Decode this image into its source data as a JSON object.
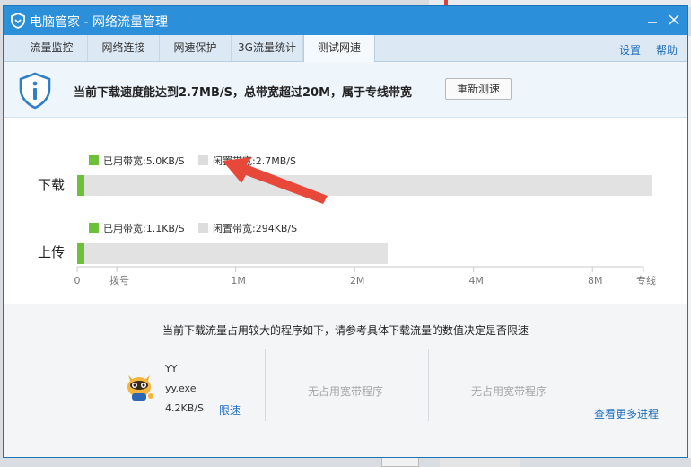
{
  "window": {
    "title": "电脑管家 - 网络流量管理"
  },
  "tabs": [
    {
      "label": "流量监控"
    },
    {
      "label": "网络连接"
    },
    {
      "label": "网速保护"
    },
    {
      "label": "3G流量统计"
    },
    {
      "label": "测试网速",
      "active": true
    }
  ],
  "toplinks": {
    "settings": "设置",
    "help": "帮助"
  },
  "banner": {
    "headline": "当前下载速度能达到2.7MB/S，总带宽超过20M，属于专线带宽",
    "retest_label": "重新测速"
  },
  "speed_chart": {
    "download": {
      "label": "下载",
      "used_legend": "已用带宽:5.0KB/S",
      "idle_legend": "闲置带宽:2.7MB/S",
      "used_fraction": 0.012,
      "total_fraction": 1.0
    },
    "upload": {
      "label": "上传",
      "used_legend": "已用带宽:1.1KB/S",
      "idle_legend": "闲置带宽:294KB/S",
      "used_fraction": 0.013,
      "total_fraction": 0.54
    },
    "axis_ticks": [
      {
        "label": "0",
        "pos": 0.0
      },
      {
        "label": "拨号",
        "pos": 0.07
      },
      {
        "label": "1M",
        "pos": 0.28
      },
      {
        "label": "2M",
        "pos": 0.49
      },
      {
        "label": "4M",
        "pos": 0.7
      },
      {
        "label": "8M",
        "pos": 0.91
      },
      {
        "label": "专线",
        "pos": 1.0
      }
    ],
    "colors": {
      "used": "#6cc03a",
      "idle": "#e2e2e2",
      "axis": "#c8c8c8",
      "legend_idle": "#dddddd"
    }
  },
  "programs": {
    "title": "当前下载流量占用较大的程序如下，请参考具体下载流量的数值决定是否限速",
    "items": [
      {
        "name": "YY",
        "exe": "yy.exe",
        "speed": "4.2KB/S",
        "limit_label": "限速"
      }
    ],
    "empty_label": "无占用宽带程序",
    "more_link": "查看更多进程"
  },
  "icons": {
    "app": "shield-logo-icon",
    "info": "shield-info-icon",
    "program": "yy-raccoon-icon"
  },
  "colors": {
    "accent": "#2b8fd9",
    "link": "#1e6ebd",
    "arrow": "#e8483a"
  }
}
